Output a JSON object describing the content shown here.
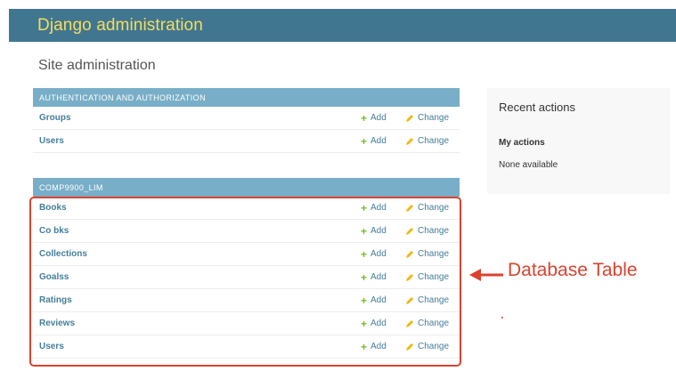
{
  "header": {
    "branding": "Django administration"
  },
  "page": {
    "title": "Site administration"
  },
  "modules": [
    {
      "caption": "AUTHENTICATION AND AUTHORIZATION",
      "rows": [
        {
          "name": "Groups",
          "add": "Add",
          "change": "Change"
        },
        {
          "name": "Users",
          "add": "Add",
          "change": "Change"
        }
      ]
    },
    {
      "caption": "COMP9900_LIM",
      "rows": [
        {
          "name": "Books",
          "add": "Add",
          "change": "Change"
        },
        {
          "name": "Co bks",
          "add": "Add",
          "change": "Change"
        },
        {
          "name": "Collections",
          "add": "Add",
          "change": "Change"
        },
        {
          "name": "Goalss",
          "add": "Add",
          "change": "Change"
        },
        {
          "name": "Ratings",
          "add": "Add",
          "change": "Change"
        },
        {
          "name": "Reviews",
          "add": "Add",
          "change": "Change"
        },
        {
          "name": "Users",
          "add": "Add",
          "change": "Change"
        }
      ]
    }
  ],
  "recent_actions": {
    "title": "Recent actions",
    "my_actions": "My actions",
    "empty": "None available"
  },
  "annotation": {
    "label": "Database Table",
    "color": "#d9432f"
  },
  "colors": {
    "header_bg": "#417690",
    "branding": "#f5dd5d",
    "caption_bg": "#79aec8",
    "link": "#447e9b",
    "add_icon": "#70bf2b",
    "change_icon": "#efb80b"
  },
  "icons": {
    "add": "plus-icon",
    "change": "pencil-icon",
    "annotation": "left-arrow-icon"
  }
}
